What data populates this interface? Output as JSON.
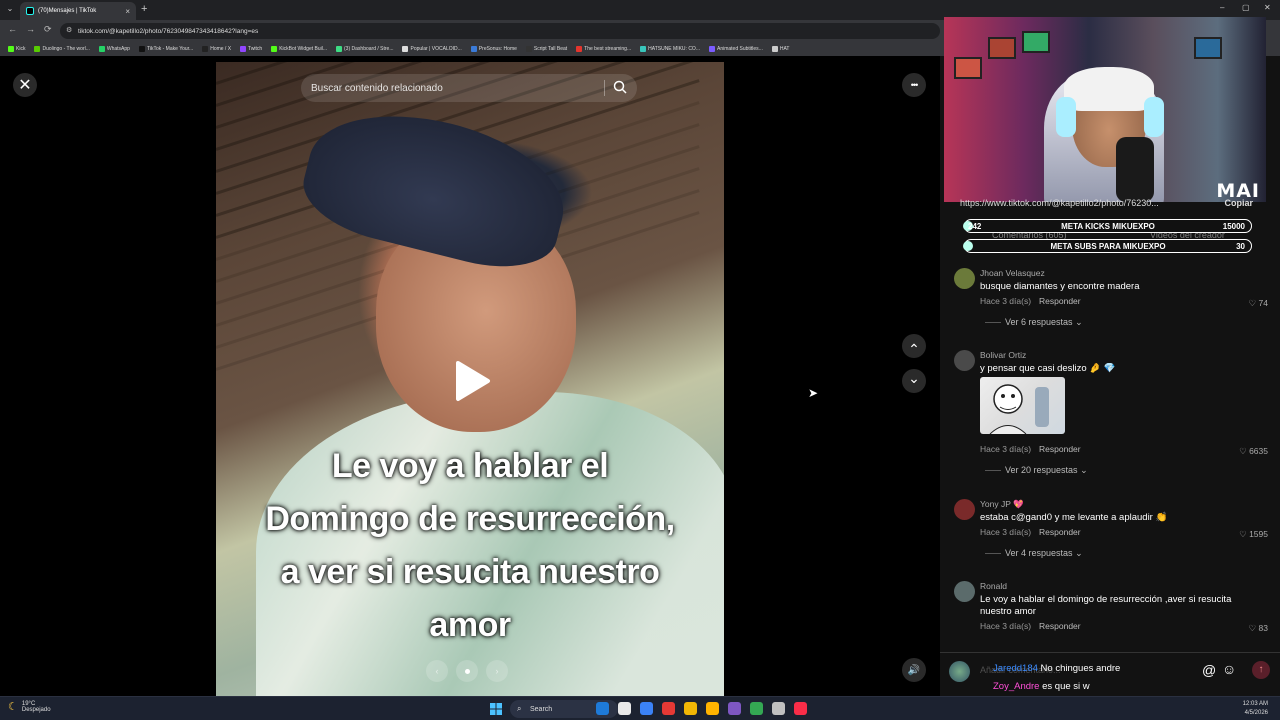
{
  "browser": {
    "tab_title": "(70)Mensajes | TikTok",
    "tab_close": "×",
    "tab_list": "⌄",
    "new_tab": "+",
    "window_controls": [
      "–",
      "▢",
      "✕"
    ],
    "nav": [
      "←",
      "→",
      "⟳"
    ],
    "url": "tiktok.com/@kapetillo2/photo/7623049847343418642?lang=es",
    "bookmarks": [
      {
        "label": "Kick",
        "color": "#53fc18"
      },
      {
        "label": "Duolingo - The worl...",
        "color": "#58cc02"
      },
      {
        "label": "WhatsApp",
        "color": "#25d366"
      },
      {
        "label": "TikTok - Make Your...",
        "color": "#111111"
      },
      {
        "label": "Home / X",
        "color": "#222222"
      },
      {
        "label": "Twitch",
        "color": "#9146ff"
      },
      {
        "label": "KickBot Widget Buil...",
        "color": "#53fc18"
      },
      {
        "label": "(3) Dashboard / Stre...",
        "color": "#3ddc84"
      },
      {
        "label": "Popular | VOCALOID...",
        "color": "#dddddd"
      },
      {
        "label": "PreSonus: Home",
        "color": "#3b7bd8"
      },
      {
        "label": "Script Tall Beat",
        "color": "#333333"
      },
      {
        "label": "The best streaming...",
        "color": "#e5352d"
      },
      {
        "label": "HATSUNE MIKU: CO...",
        "color": "#39c5bb"
      },
      {
        "label": "Animated Subtitles...",
        "color": "#7b5cff"
      },
      {
        "label": "HAT",
        "color": "#cccccc"
      }
    ]
  },
  "viewer": {
    "close_icon": "✕",
    "more_icon": "•••",
    "search_placeholder": "Buscar contenido relacionado",
    "caption_lines": [
      "Le voy a hablar el",
      "Domingo de resurrección,",
      "a ver si resucita nuestro",
      "amor"
    ],
    "up_icon": "⌃",
    "down_icon": "⌄",
    "volume_icon": "🔊",
    "carousel_prev": "‹",
    "carousel_next": "›"
  },
  "stream_overlay": {
    "brand": "MAI",
    "link_text": "https://www.tiktok.com/@kapetillo2/photo/76230...",
    "copy_label": "Copiar",
    "goal1": {
      "start": "242",
      "label": "META KICKS MIKUEXPO",
      "target": "15000",
      "fill": 0.016
    },
    "goal2": {
      "start": "",
      "label": "META SUBS PARA MIKUEXPO",
      "target": "30",
      "fill": 0.0
    },
    "tab_comments": "Comentarios (605)",
    "tab_creator": "Videos del creador"
  },
  "comments": [
    {
      "user": "Jhoan Velasquez",
      "text": "busque diamantes y encontre madera",
      "time": "Hace 3 día(s)",
      "reply": "Responder",
      "likes": "74",
      "replies": "Ver 6 respuestas",
      "avatar": "#6b7a3a"
    },
    {
      "user": "Bolivar Ortiz",
      "text": "y pensar que casi deslizo 🤌 💎",
      "time": "Hace 3 día(s)",
      "reply": "Responder",
      "likes": "6635",
      "replies": "Ver 20 respuestas",
      "avatar": "#4a4a4a"
    },
    {
      "user": "Yony JP 💖",
      "text": "estaba c@gand0 y me levante a aplaudir 👏",
      "time": "Hace 3 día(s)",
      "reply": "Responder",
      "likes": "1595",
      "replies": "Ver 4 respuestas",
      "avatar": "#7a2a2a"
    },
    {
      "user": "Ronald",
      "text": "Le voy a hablar el domingo de resurrección ,aver si resucita nuestro amor",
      "time": "Hace 3 día(s)",
      "reply": "Responder",
      "likes": "83",
      "replies": "",
      "avatar": "#5b6b6b"
    }
  ],
  "compose": {
    "placeholder": "Añadir comentario...",
    "chat": [
      {
        "user": "Jaredd184",
        "color": "#3b8bff",
        "msg": "No chingues andre"
      },
      {
        "user": "Zoy_Andre",
        "color": "#ff4fd8",
        "msg": "es que si w"
      }
    ],
    "at_icon": "@",
    "emoji_icon": "☺",
    "send_icon": "↑"
  },
  "taskbar": {
    "temp": "19°C",
    "weather": "Despejado",
    "search": "Search",
    "time": "12:03 AM",
    "date": "4/5/2026",
    "apps": [
      "#1e7ad8",
      "#e9e9e9",
      "#3b82f6",
      "#e53935",
      "#f2b705",
      "#ffb300",
      "#7e57c2",
      "#34a853",
      "#c0c0c0",
      "#fa2d48"
    ]
  }
}
